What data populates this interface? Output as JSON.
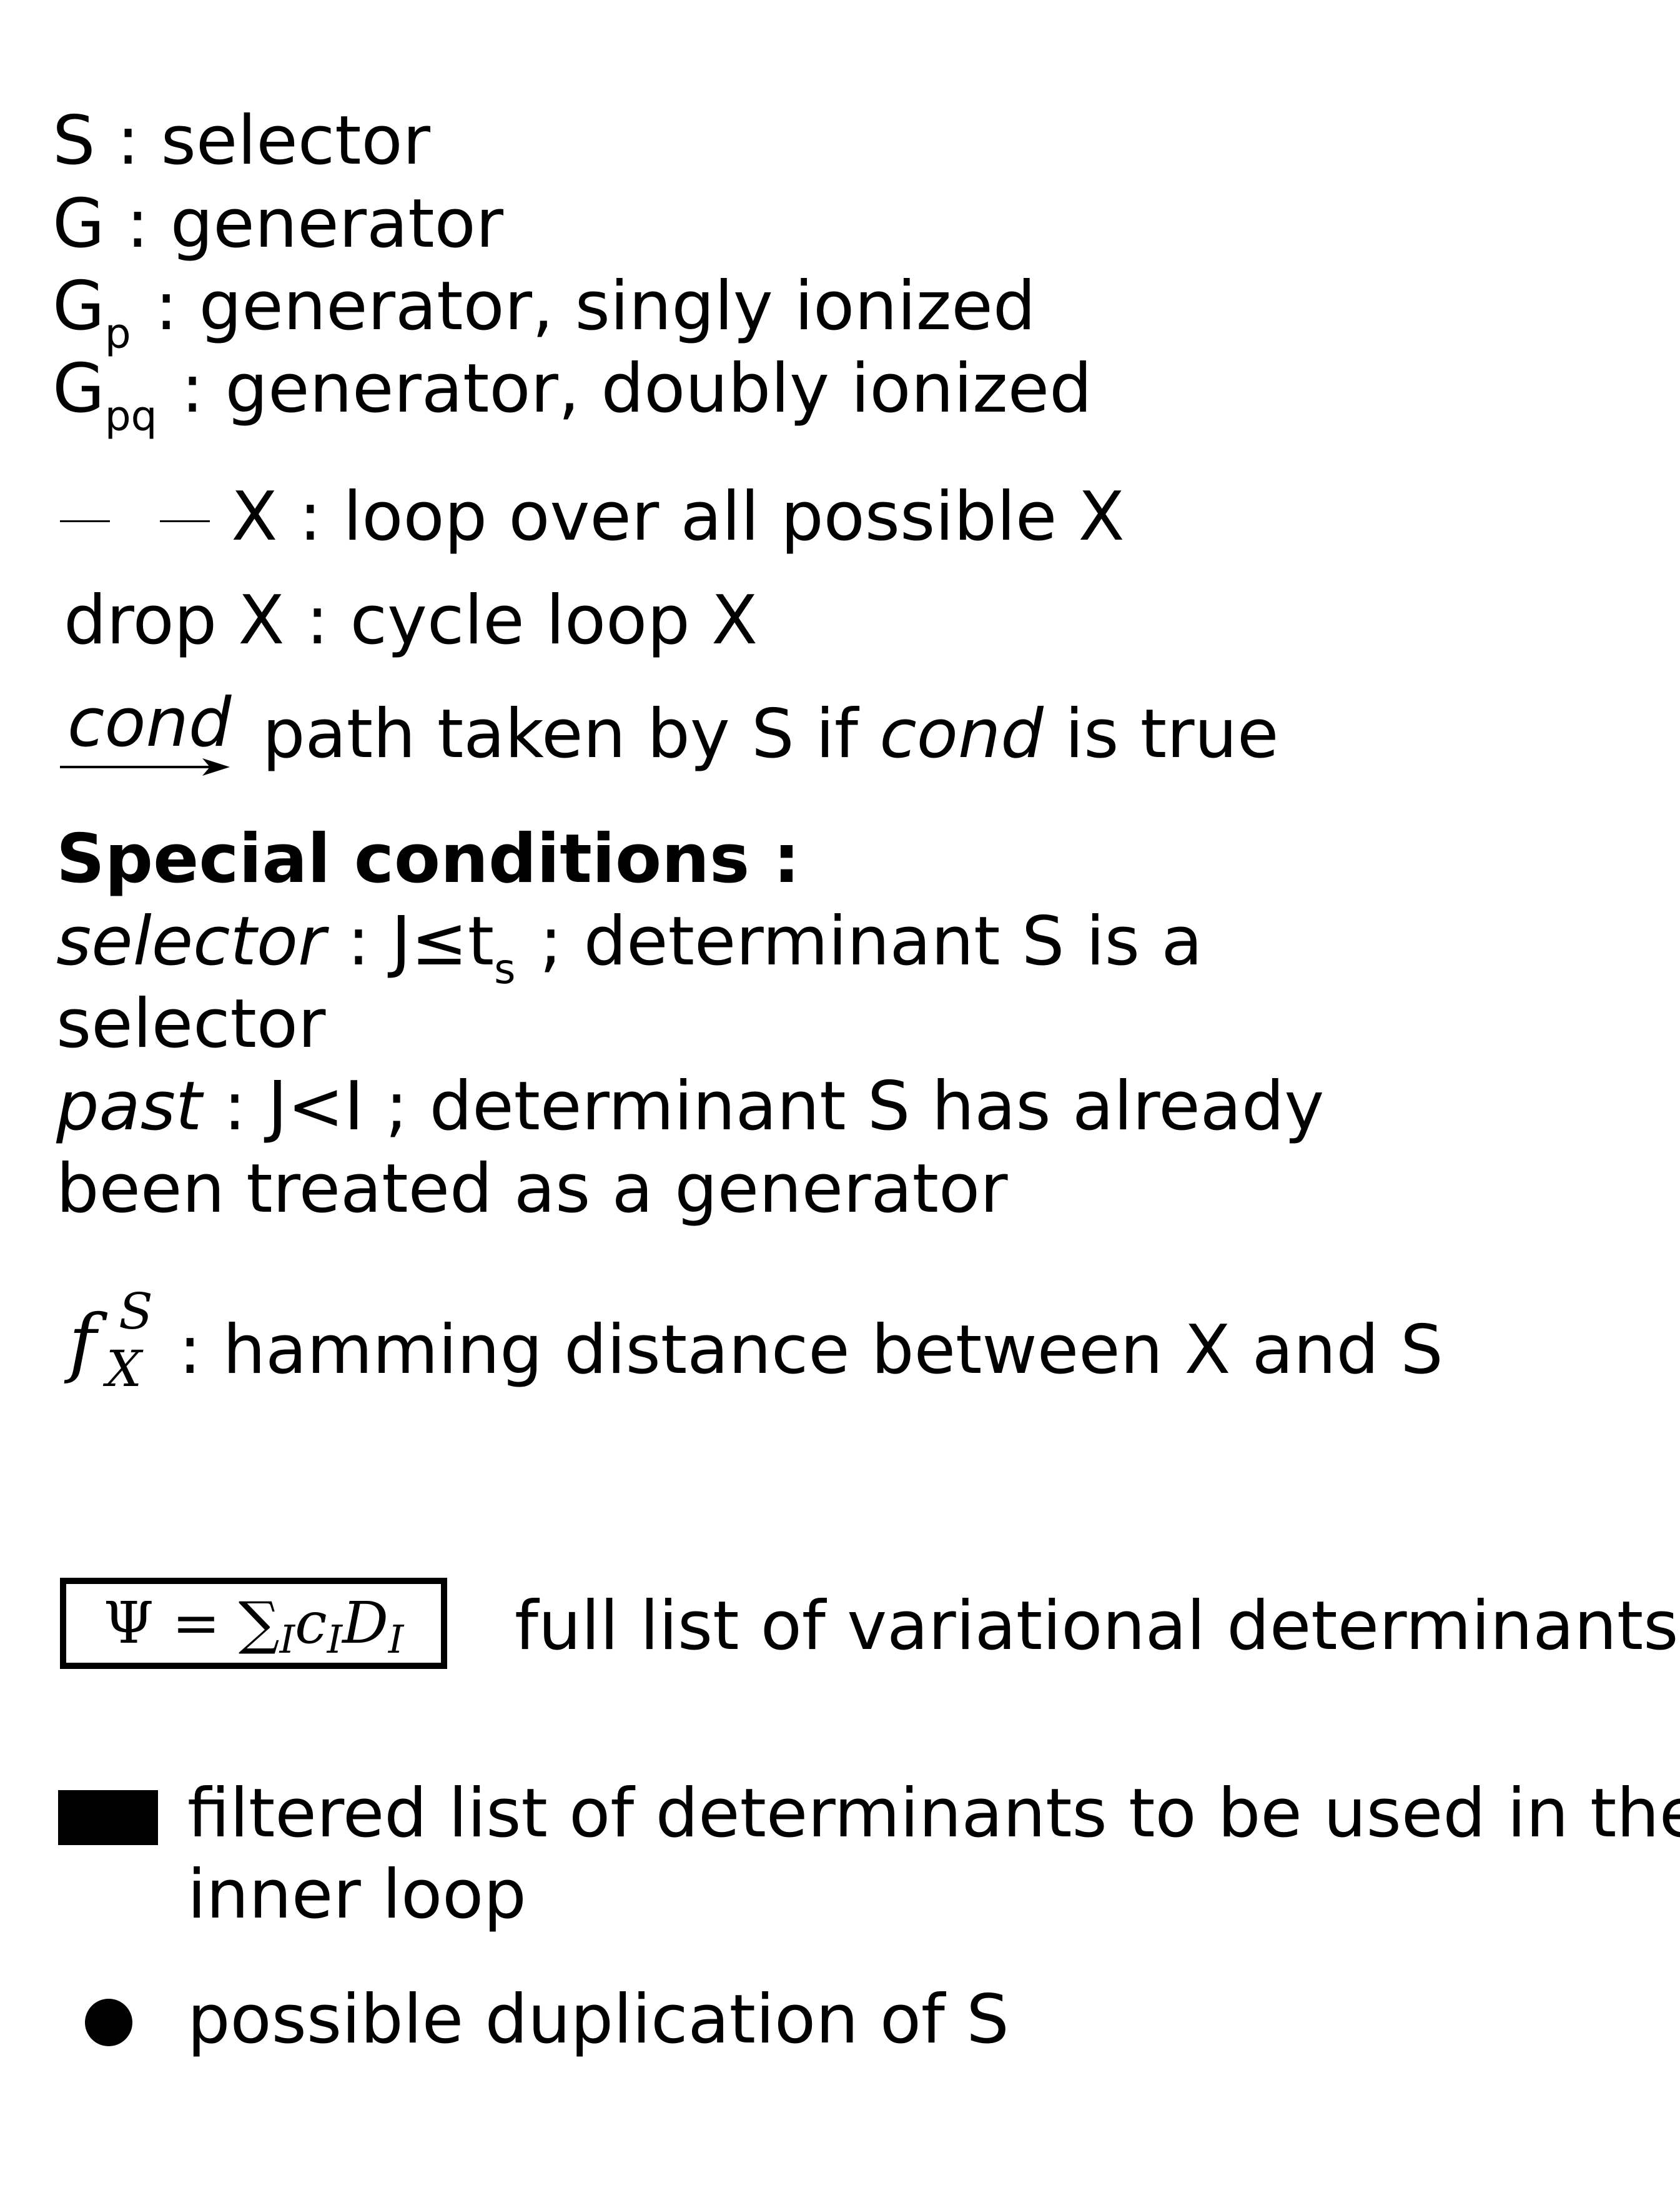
{
  "legend": {
    "roles": [
      {
        "symbol": "S",
        "sub": "",
        "desc": " : selector"
      },
      {
        "symbol": "G",
        "sub": "",
        "desc": " : generator"
      },
      {
        "symbol": "G",
        "sub": "p",
        "desc": ": generator, singly ionized"
      },
      {
        "symbol": "G",
        "sub": "pq",
        "desc": ": generator, doubly ionized"
      }
    ],
    "loop": {
      "text": "X : loop over all possible X"
    },
    "drop": {
      "text": "drop X : cycle loop X"
    },
    "path": {
      "cond_label": "cond",
      "text_before": "path taken by S if ",
      "cond_word": "cond",
      "text_after": " is true"
    },
    "special": {
      "heading": "Special conditions :",
      "selector_word": "selector",
      "selector_rest_a": " : J≤t",
      "selector_sub": "s",
      "selector_rest_b": " ; determinant S is a",
      "selector_line2": "selector",
      "past_word": "past",
      "past_rest": " : J<I ; determinant S has already",
      "past_line2": "been treated as a generator"
    },
    "hamming": {
      "f": "f",
      "sup": "S",
      "sub": "X",
      "text": ": hamming distance between X and S"
    },
    "psi": {
      "formula_left": "Ψ = ∑",
      "formula_sub": "I",
      "formula_right": " c",
      "formula_sub2": "I",
      "formula_d": "D",
      "formula_sub3": "I",
      "text": "full list of variational determinants"
    },
    "filtered": {
      "line1": "filtered list of determinants to be used in the",
      "line2": "inner loop"
    },
    "duplication": {
      "text": "possible duplication of S"
    }
  }
}
